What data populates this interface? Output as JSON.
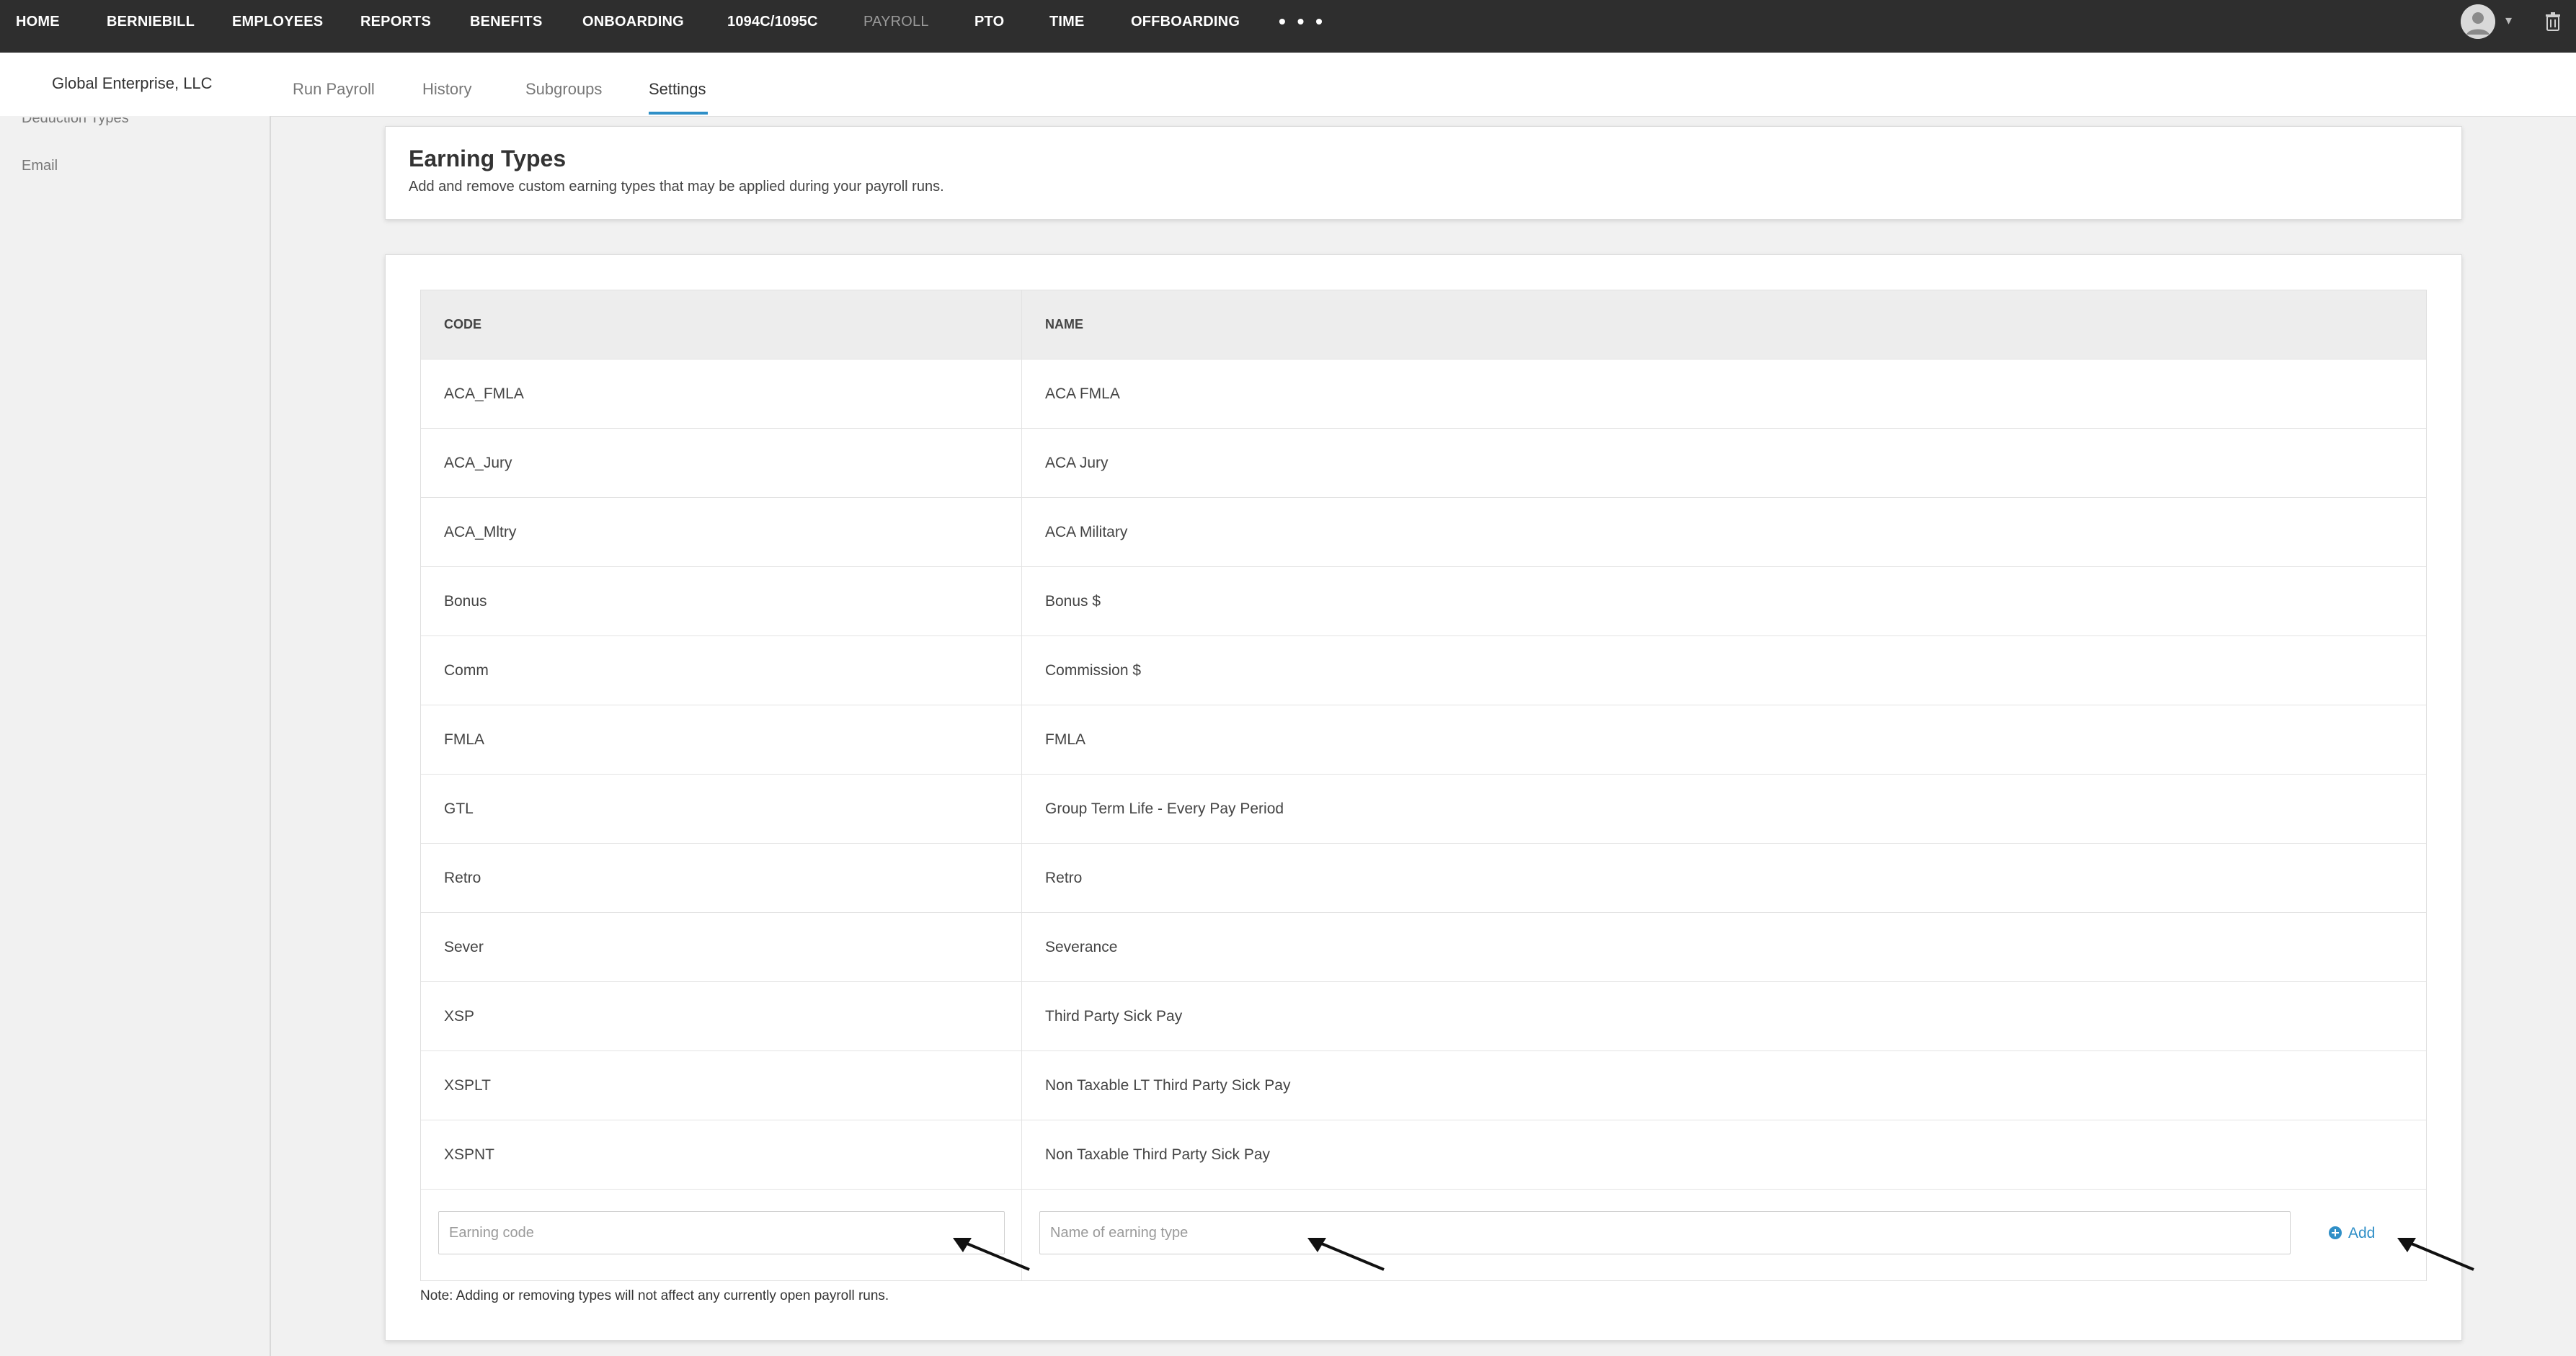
{
  "topnav": {
    "items": [
      "HOME",
      "BERNIEBILL",
      "EMPLOYEES",
      "REPORTS",
      "BENEFITS",
      "ONBOARDING",
      "1094C/1095C",
      "PAYROLL",
      "PTO",
      "TIME",
      "OFFBOARDING"
    ],
    "more": "• • •",
    "active_dim": "PAYROLL"
  },
  "subheader": {
    "company": "Global Enterprise, LLC",
    "tabs": [
      "Run Payroll",
      "History",
      "Subgroups",
      "Settings"
    ],
    "active_tab": "Settings"
  },
  "sidebar": {
    "items": [
      "Deduction Types",
      "Email"
    ]
  },
  "earning_types": {
    "title": "Earning Types",
    "description": "Add and remove custom earning types that may be applied during your payroll runs.",
    "columns": {
      "code": "CODE",
      "name": "NAME"
    },
    "rows": [
      {
        "code": "ACA_FMLA",
        "name": "ACA FMLA"
      },
      {
        "code": "ACA_Jury",
        "name": "ACA Jury"
      },
      {
        "code": "ACA_Mltry",
        "name": "ACA Military"
      },
      {
        "code": "Bonus",
        "name": "Bonus $"
      },
      {
        "code": "Comm",
        "name": "Commission $"
      },
      {
        "code": "FMLA",
        "name": "FMLA"
      },
      {
        "code": "GTL",
        "name": "Group Term Life - Every Pay Period"
      },
      {
        "code": "Retro",
        "name": "Retro"
      },
      {
        "code": "Sever",
        "name": "Severance"
      },
      {
        "code": "XSP",
        "name": "Third Party Sick Pay"
      },
      {
        "code": "XSPLT",
        "name": "Non Taxable LT Third Party Sick Pay"
      },
      {
        "code": "XSPNT",
        "name": "Non Taxable Third Party Sick Pay"
      }
    ],
    "code_input": {
      "placeholder": "Earning code",
      "value": ""
    },
    "name_input": {
      "placeholder": "Name of earning type",
      "value": ""
    },
    "add_label": "Add",
    "note": "Note: Adding or removing types will not affect any currently open payroll runs."
  },
  "colors": {
    "nav_bg": "#2e2e2e",
    "accent": "#2f8fc7",
    "page_bg": "#f1f1f1"
  }
}
